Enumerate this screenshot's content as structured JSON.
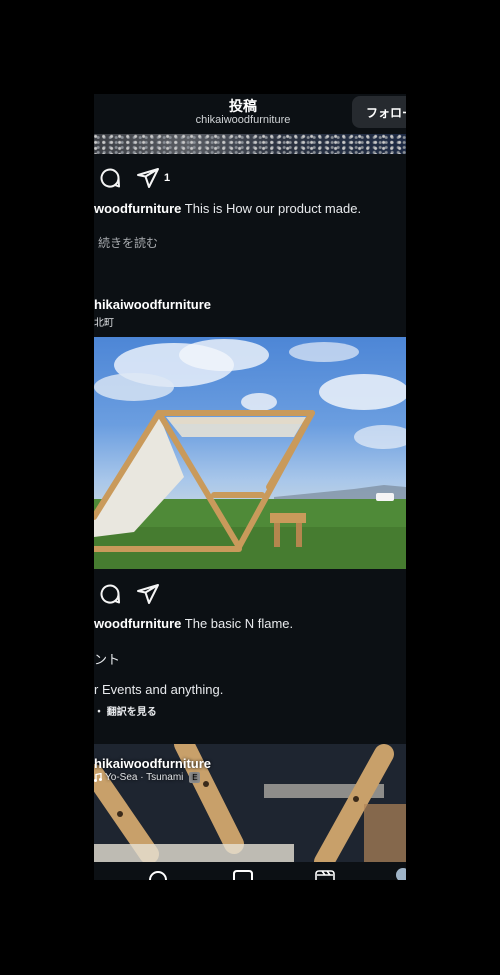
{
  "header": {
    "title": "投稿",
    "subtitle": "chikaiwoodfurniture",
    "follow_label": "フォロー"
  },
  "post1": {
    "share_count": "1",
    "caption_user": "woodfurniture",
    "caption_text": " This is How our product made.",
    "more_label": "続きを読む"
  },
  "post2": {
    "username": "hikaiwoodfurniture",
    "location": "北町",
    "caption_user": "woodfurniture",
    "caption_text": " The basic N flame.",
    "line2": "ント",
    "line3": "r Events and anything.",
    "translate": "・ 翻訳を見る"
  },
  "post3": {
    "username": "hikaiwoodfurniture",
    "music": "Yo-Sea · Tsunami",
    "explicit_badge": "E"
  },
  "colors": {
    "background": "#0c1014",
    "outer": "#000000",
    "follow_button": "#262a2f"
  }
}
